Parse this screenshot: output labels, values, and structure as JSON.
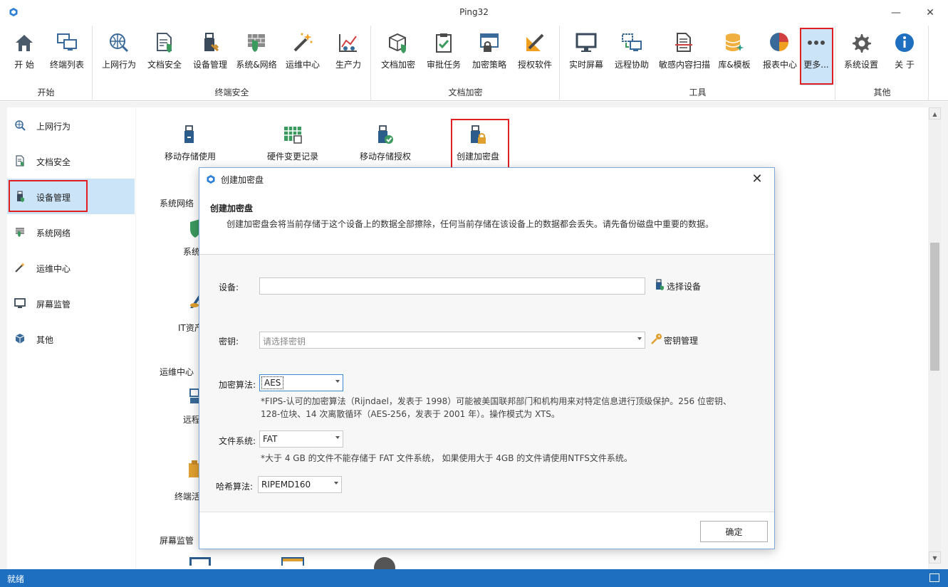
{
  "window": {
    "title": "Ping32",
    "minimize": "—",
    "close": "✕"
  },
  "ribbon": {
    "groups": [
      {
        "label": "开始",
        "items": [
          {
            "label": "开 始"
          },
          {
            "label": "终端列表"
          }
        ]
      },
      {
        "label": "终端安全",
        "items": [
          {
            "label": "上网行为"
          },
          {
            "label": "文档安全"
          },
          {
            "label": "设备管理"
          },
          {
            "label": "系统&网络"
          },
          {
            "label": "运维中心"
          },
          {
            "label": "生产力"
          }
        ]
      },
      {
        "label": "文档加密",
        "items": [
          {
            "label": "文档加密"
          },
          {
            "label": "审批任务"
          },
          {
            "label": "加密策略"
          },
          {
            "label": "授权软件"
          }
        ]
      },
      {
        "label": "工具",
        "items": [
          {
            "label": "实时屏幕"
          },
          {
            "label": "远程协助"
          },
          {
            "label": "敏感内容扫描"
          },
          {
            "label": "库&模板"
          },
          {
            "label": "报表中心"
          },
          {
            "label": "更多..."
          }
        ]
      },
      {
        "label": "其他",
        "items": [
          {
            "label": "系统设置"
          },
          {
            "label": "关 于"
          }
        ]
      }
    ]
  },
  "sidebar": {
    "items": [
      {
        "label": "上网行为"
      },
      {
        "label": "文档安全"
      },
      {
        "label": "设备管理"
      },
      {
        "label": "系统网络"
      },
      {
        "label": "运维中心"
      },
      {
        "label": "屏幕监管"
      },
      {
        "label": "其他"
      }
    ]
  },
  "content": {
    "device_buttons": [
      {
        "label": "移动存储使用"
      },
      {
        "label": "硬件变更记录"
      },
      {
        "label": "移动存储授权"
      },
      {
        "label": "创建加密盘"
      }
    ],
    "sections": {
      "network": "系统网络",
      "ops": "运维中心",
      "screen": "屏幕监管"
    },
    "partials": {
      "sys": "系统",
      "it": "IT资产",
      "remote": "远程",
      "term": "终端活"
    }
  },
  "dialog": {
    "title": "创建加密盘",
    "close": "✕",
    "heading": "创建加密盘",
    "description": "创建加密盘会将当前存储于这个设备上的数据全部擦除，任何当前存储在该设备上的数据都会丢失。请先备份磁盘中重要的数据。",
    "device": {
      "label": "设备:",
      "value": "",
      "link": "选择设备"
    },
    "key": {
      "label": "密钥:",
      "placeholder": "请选择密钥",
      "link": "密钥管理"
    },
    "algorithm": {
      "label": "加密算法:",
      "value": "AES",
      "note_line1": "*FIPS-认可的加密算法（Rijndael，发表于 1998）可能被美国联邦部门和机构用来对特定信息进行顶级保护。256 位密钥、",
      "note_line2": "128-位块、14 次离散循环（AES-256，发表于 2001 年）。操作模式为 XTS。"
    },
    "filesystem": {
      "label": "文件系统:",
      "value": "FAT",
      "note": "*大于 4 GB 的文件不能存储于 FAT 文件系统， 如果使用大于 4GB 的文件请使用NTFS文件系统。"
    },
    "hash": {
      "label": "哈希算法:",
      "value": "RIPEMD160"
    },
    "ok_label": "确定"
  },
  "status": {
    "text": "就绪"
  },
  "colors": {
    "accent": "#1e6fc0",
    "highlight": "#cce4f7",
    "annotation": "#e02020"
  }
}
